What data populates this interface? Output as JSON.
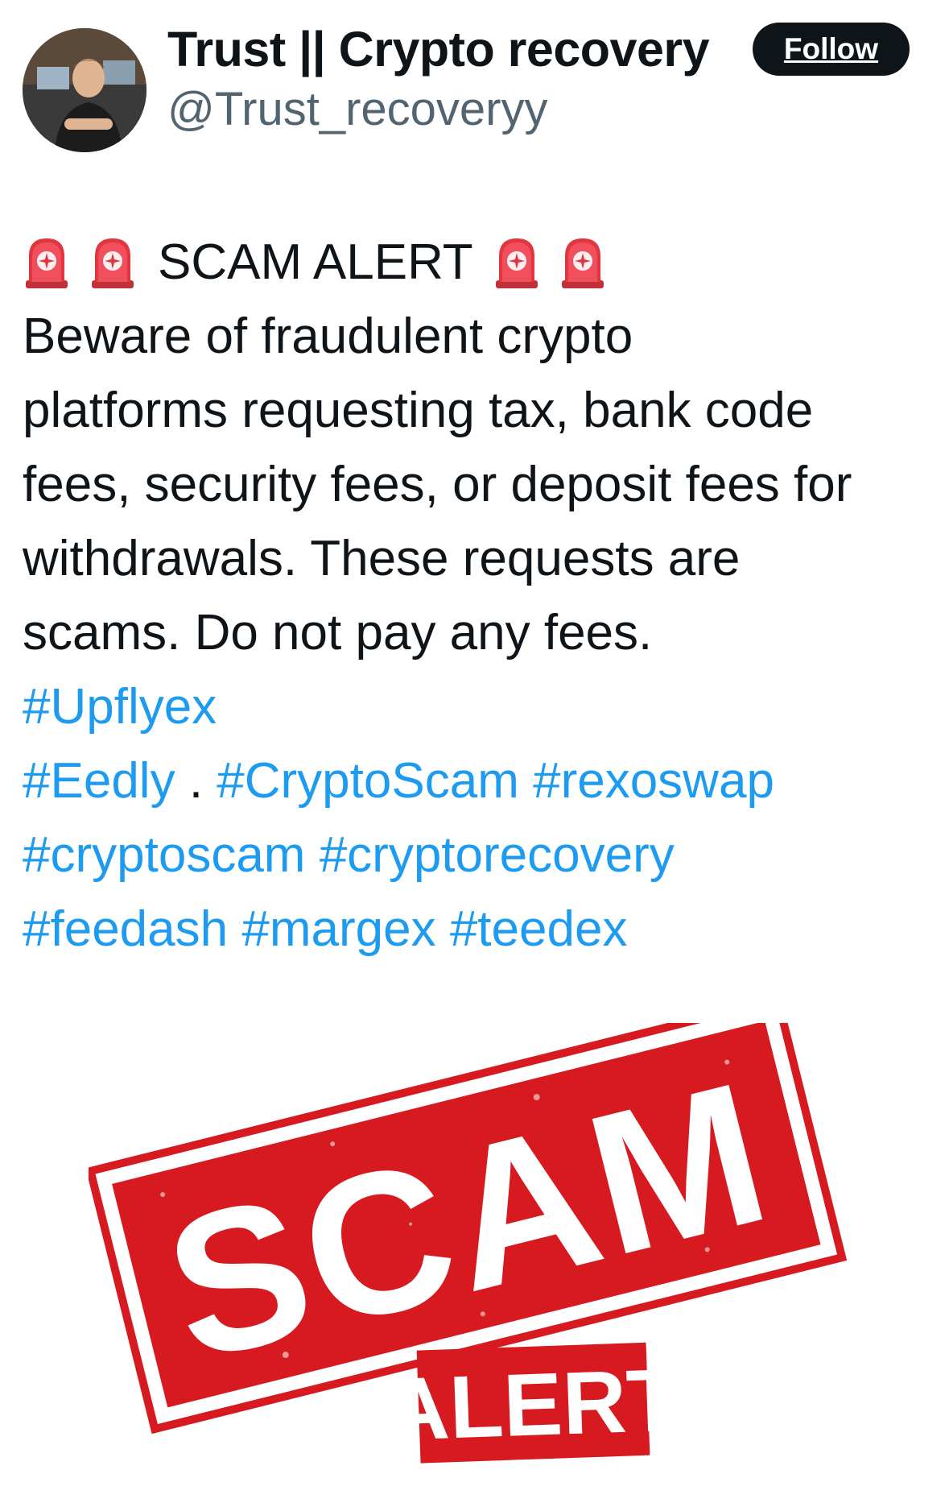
{
  "post": {
    "author": {
      "display_name": "Trust || Crypto recovery",
      "handle": "@Trust_recoveryy",
      "avatar_icon": "profile-photo"
    },
    "follow_label": "Follow",
    "alert_title": "SCAM ALERT",
    "alert_icon": "police-siren-emoji",
    "body_lines": [
      "Beware of fraudulent crypto",
      "platforms requesting tax, bank code",
      "fees, security fees, or deposit fees for",
      "withdrawals. These requests are",
      "scams. Do not pay any fees."
    ],
    "hashtag_rows": [
      [
        "#Upflyex"
      ],
      [
        "#Eedly",
        ".",
        "#CryptoScam",
        "#rexoswap"
      ],
      [
        "#cryptoscam",
        "#cryptorecovery"
      ],
      [
        "#feedash",
        "#margex",
        "#teedex"
      ]
    ],
    "image": {
      "stamp_word": "SCAM",
      "stamp_sub": "ALERT",
      "stamp_color": "#d71920"
    }
  },
  "colors": {
    "text": "#0f1419",
    "secondary": "#536471",
    "link": "#1d9bf0",
    "follow_bg": "#0f1419"
  }
}
